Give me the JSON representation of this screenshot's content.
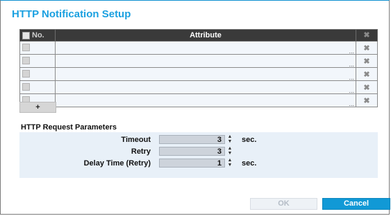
{
  "dialog": {
    "title": "HTTP Notification Setup"
  },
  "table": {
    "headers": {
      "no": "No.",
      "attribute": "Attribute",
      "delete_icon": "close-icon"
    },
    "rows": [
      {
        "ellipsis": "..."
      },
      {
        "ellipsis": "..."
      },
      {
        "ellipsis": "..."
      },
      {
        "ellipsis": "..."
      },
      {
        "ellipsis": "..."
      }
    ],
    "add_label": "+"
  },
  "params": {
    "title": "HTTP Request Parameters",
    "timeout": {
      "label": "Timeout",
      "value": "3",
      "unit": "sec."
    },
    "retry": {
      "label": "Retry",
      "value": "3"
    },
    "delay": {
      "label": "Delay Time (Retry)",
      "value": "1",
      "unit": "sec."
    }
  },
  "buttons": {
    "ok": "OK",
    "cancel": "Cancel"
  },
  "colors": {
    "accent": "#1aa0e0",
    "header_bg": "#3a3a3a",
    "cancel_bg": "#1199d6"
  }
}
